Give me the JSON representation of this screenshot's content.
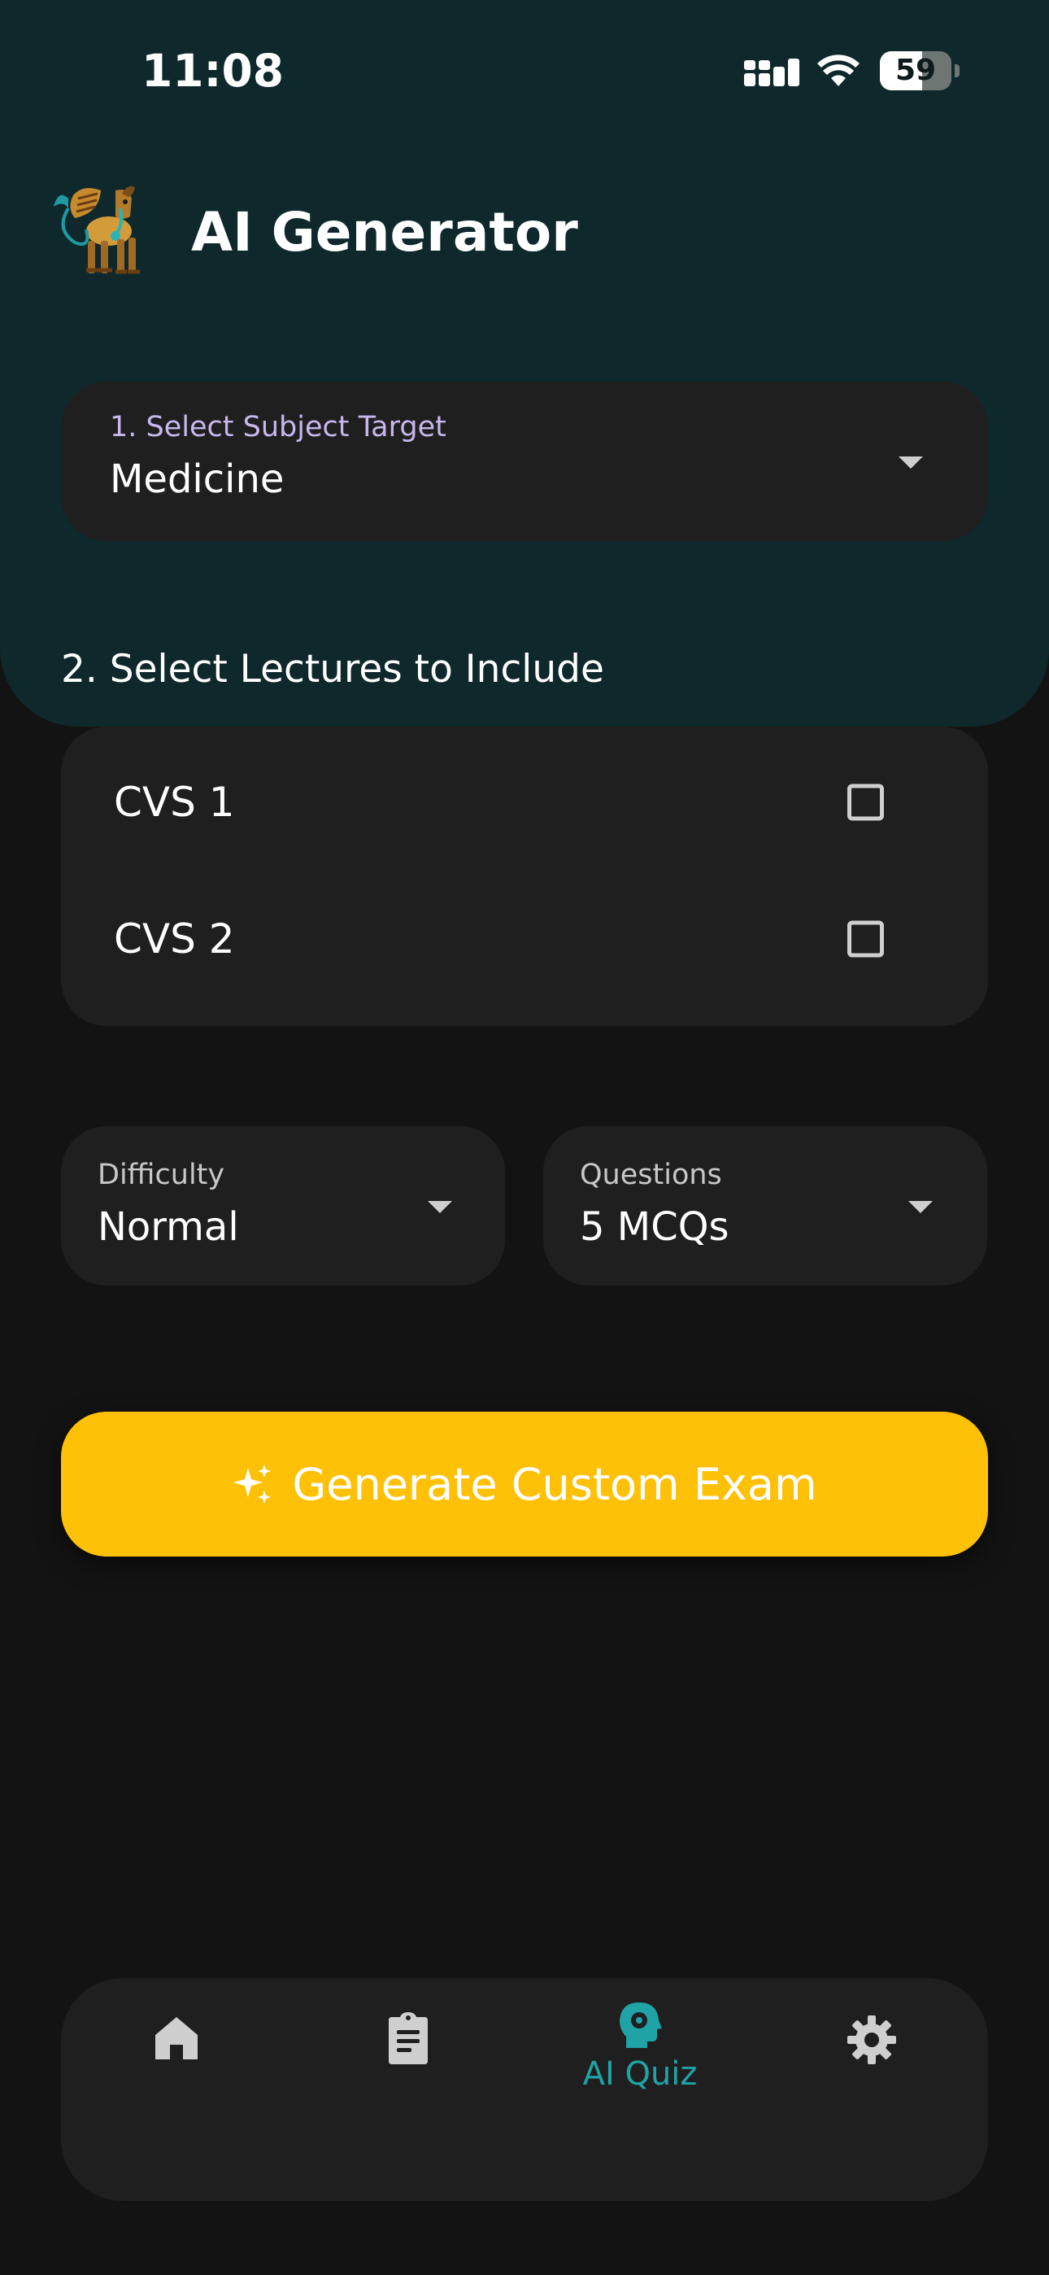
{
  "status_bar": {
    "time": "11:08",
    "battery_level": 59,
    "battery_text": "59"
  },
  "header": {
    "title": "AI Generator",
    "logo_icon": "winged-lamassu-logo"
  },
  "subject": {
    "label": "1. Select Subject Target",
    "value": "Medicine"
  },
  "lectures": {
    "title": "2. Select Lectures to Include",
    "items": [
      {
        "label": "CVS 1",
        "checked": false
      },
      {
        "label": "CVS 2",
        "checked": false
      }
    ]
  },
  "difficulty": {
    "label": "Difficulty",
    "value": "Normal"
  },
  "questions": {
    "label": "Questions",
    "value": "5 MCQs"
  },
  "generate_button": {
    "label": "Generate Custom Exam",
    "icon": "sparkles-icon"
  },
  "bottom_nav": {
    "items": [
      {
        "icon": "home-icon",
        "label": ""
      },
      {
        "icon": "clipboard-icon",
        "label": ""
      },
      {
        "icon": "ai-brain-icon",
        "label": "AI Quiz",
        "active": true
      },
      {
        "icon": "gear-icon",
        "label": ""
      }
    ]
  },
  "colors": {
    "header_bg": "#0e282c",
    "page_bg": "#131313",
    "card_bg": "#1f1f1f",
    "accent": "#ffc107",
    "active_tab": "#20a3a6",
    "subject_label": "#c7b7ee"
  }
}
